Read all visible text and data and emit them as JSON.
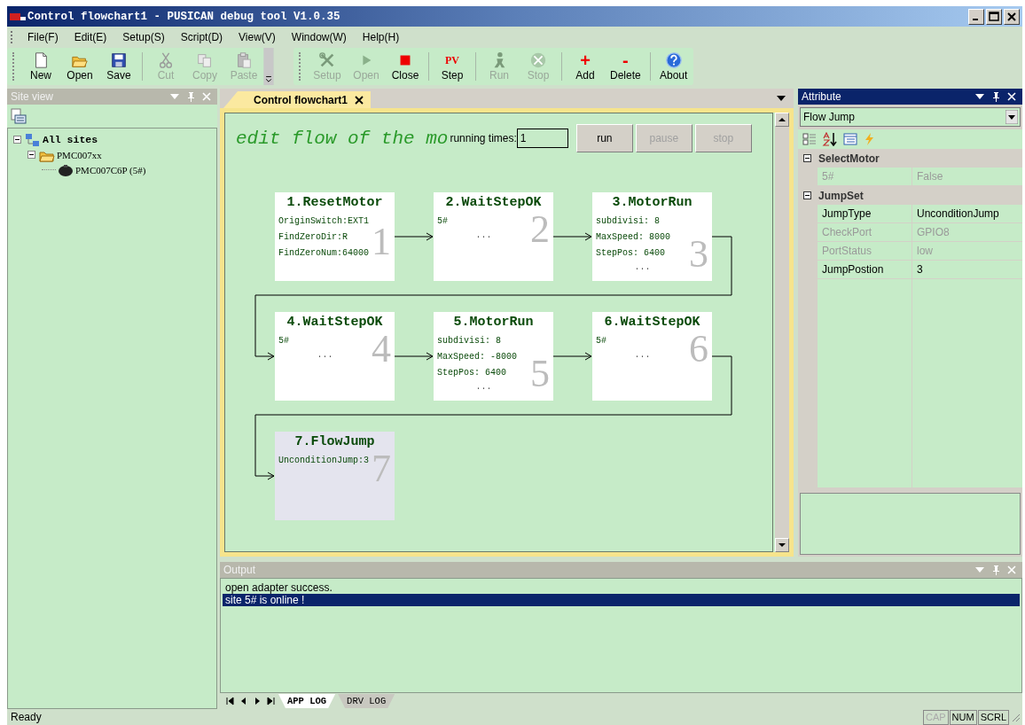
{
  "window": {
    "title": "Control flowchart1 - PUSICAN debug tool V1.0.35"
  },
  "menu": [
    "File(F)",
    "Edit(E)",
    "Setup(S)",
    "Script(D)",
    "View(V)",
    "Window(W)",
    "Help(H)"
  ],
  "toolbars": [
    {
      "buttons": [
        {
          "kind": "button",
          "label": "New",
          "disabled": false
        },
        {
          "kind": "button",
          "label": "Open",
          "disabled": false
        },
        {
          "kind": "button",
          "label": "Save",
          "disabled": false
        },
        {
          "kind": "separator"
        },
        {
          "kind": "button",
          "label": "Cut",
          "disabled": true
        },
        {
          "kind": "button",
          "label": "Copy",
          "disabled": true
        },
        {
          "kind": "button",
          "label": "Paste",
          "disabled": true
        }
      ]
    },
    {
      "buttons": [
        {
          "kind": "button",
          "label": "Setup",
          "disabled": true
        },
        {
          "kind": "button",
          "label": "Open",
          "disabled": true
        },
        {
          "kind": "button",
          "label": "Close",
          "disabled": false
        },
        {
          "kind": "separator"
        },
        {
          "kind": "button",
          "label": "Step",
          "glyph": "PV",
          "disabled": false
        },
        {
          "kind": "separator"
        },
        {
          "kind": "button",
          "label": "Run",
          "disabled": true
        },
        {
          "kind": "button",
          "label": "Stop",
          "disabled": true
        },
        {
          "kind": "separator"
        },
        {
          "kind": "button",
          "label": "Add",
          "glyph": "+",
          "disabled": false
        },
        {
          "kind": "button",
          "label": "Delete",
          "glyph": "-",
          "disabled": false
        },
        {
          "kind": "separator"
        },
        {
          "kind": "button",
          "label": "About",
          "disabled": false
        }
      ]
    }
  ],
  "site_view": {
    "title": "Site view",
    "active": false,
    "tree": [
      {
        "label": "All sites",
        "expanded": true,
        "children": [
          {
            "label": "PMC007xx",
            "expanded": true,
            "children": [
              {
                "label": "PMC007C6P (5#)"
              }
            ]
          }
        ]
      }
    ]
  },
  "document": {
    "tabs": [
      {
        "label": "Control flowchart1",
        "selected": true
      }
    ],
    "heading": "edit flow of the mo",
    "running_label": "running times:",
    "running_value": "1",
    "buttons": [
      {
        "label": "run",
        "disabled": false
      },
      {
        "label": "pause",
        "disabled": true
      },
      {
        "label": "stop",
        "disabled": true
      }
    ],
    "nodes": [
      {
        "title": "1.ResetMotor",
        "number": "1",
        "lines": [
          "OriginSwitch:EXT1",
          "FindZeroDir:R",
          "FindZeroNum:64000"
        ],
        "selected": false
      },
      {
        "title": "2.WaitStepOK",
        "number": "2",
        "lines": [
          "5#"
        ],
        "ellipsis": "...",
        "selected": false
      },
      {
        "title": "3.MotorRun",
        "number": "3",
        "lines": [
          "subdivisi: 8",
          "MaxSpeed: 8000",
          "StepPos: 6400"
        ],
        "ellipsis": "...",
        "selected": false
      },
      {
        "title": "4.WaitStepOK",
        "number": "4",
        "lines": [
          "5#"
        ],
        "ellipsis": "...",
        "selected": false
      },
      {
        "title": "5.MotorRun",
        "number": "5",
        "lines": [
          "subdivisi: 8",
          "MaxSpeed: -8000",
          "StepPos: 6400"
        ],
        "ellipsis": "...",
        "selected": false
      },
      {
        "title": "6.WaitStepOK",
        "number": "6",
        "lines": [
          "5#"
        ],
        "ellipsis": "...",
        "selected": false
      },
      {
        "title": "7.FlowJump",
        "number": "7",
        "lines": [
          "UnconditionJump:3"
        ],
        "selected": true
      }
    ]
  },
  "attribute": {
    "title": "Attribute",
    "active": true,
    "object": "Flow Jump",
    "categories": [
      {
        "name": "SelectMotor",
        "expanded": true,
        "rows": [
          {
            "name": "5#",
            "value": "False",
            "disabled": true
          }
        ]
      },
      {
        "name": "JumpSet",
        "expanded": true,
        "rows": [
          {
            "name": "JumpType",
            "value": "UnconditionJump",
            "disabled": false
          },
          {
            "name": "CheckPort",
            "value": "GPIO8",
            "disabled": true
          },
          {
            "name": "PortStatus",
            "value": "low",
            "disabled": true
          },
          {
            "name": "JumpPostion",
            "value": "3",
            "disabled": false
          }
        ]
      }
    ]
  },
  "output": {
    "title": "Output",
    "active": false,
    "lines": [
      {
        "text": "open adapter success.",
        "selected": false
      },
      {
        "text": "site 5# is online !",
        "selected": true
      }
    ],
    "tabs": [
      {
        "label": "APP LOG",
        "selected": true
      },
      {
        "label": "DRV LOG",
        "selected": false
      }
    ]
  },
  "status_bar": {
    "text": "Ready",
    "indicators": [
      {
        "label": "CAP",
        "on": false
      },
      {
        "label": "NUM",
        "on": true
      },
      {
        "label": "SCRL",
        "on": true
      }
    ]
  }
}
